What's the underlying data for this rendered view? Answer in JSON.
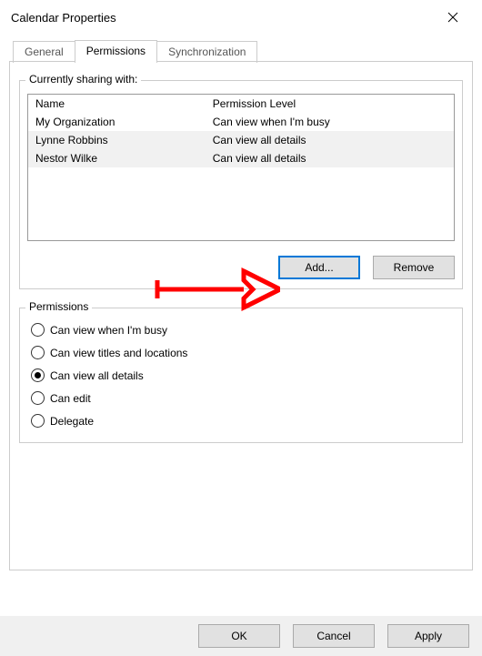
{
  "title": "Calendar Properties",
  "tabs": {
    "general": "General",
    "permissions": "Permissions",
    "synchronization": "Synchronization"
  },
  "sharing": {
    "legend": "Currently sharing with:",
    "headers": {
      "name": "Name",
      "level": "Permission Level"
    },
    "rows": [
      {
        "name": "My Organization",
        "level": "Can view when I'm busy"
      },
      {
        "name": "Lynne Robbins",
        "level": "Can view all details"
      },
      {
        "name": "Nestor Wilke",
        "level": "Can view all details"
      }
    ]
  },
  "buttons": {
    "add": "Add...",
    "remove": "Remove",
    "ok": "OK",
    "cancel": "Cancel",
    "apply": "Apply"
  },
  "permissions": {
    "legend": "Permissions",
    "options": {
      "busy": "Can view when I'm busy",
      "titles": "Can view titles and locations",
      "details": "Can view all details",
      "edit": "Can edit",
      "delegate": "Delegate"
    }
  }
}
